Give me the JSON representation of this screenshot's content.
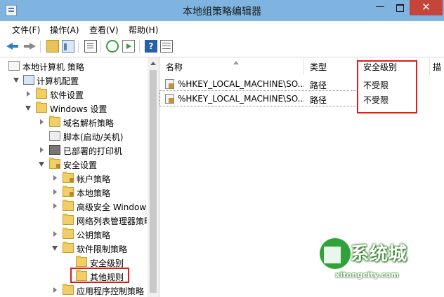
{
  "window": {
    "title": "本地组策略编辑器",
    "minimize": "—",
    "close": "✕"
  },
  "menu": [
    "文件(F)",
    "操作(A)",
    "查看(V)",
    "帮助(H)"
  ],
  "toolbar": {
    "help_glyph": "?"
  },
  "tree": [
    {
      "label": "本地计算机 策略",
      "icon": "policy-doc-icon"
    },
    {
      "label": "计算机配置",
      "icon": "computer-icon"
    },
    {
      "label": "软件设置",
      "icon": "folder-icon"
    },
    {
      "label": "Windows 设置",
      "icon": "folder-icon"
    },
    {
      "label": "域名解析策略",
      "icon": "folder-icon"
    },
    {
      "label": "脚本(启动/关机)",
      "icon": "script-icon"
    },
    {
      "label": "已部署的打印机",
      "icon": "printer-icon"
    },
    {
      "label": "安全设置",
      "icon": "secure-folder-icon"
    },
    {
      "label": "帐户策略",
      "icon": "secure-folder-icon"
    },
    {
      "label": "本地策略",
      "icon": "secure-folder-icon"
    },
    {
      "label": "高级安全 Windows",
      "icon": "folder-icon"
    },
    {
      "label": "网络列表管理器策略",
      "icon": "folder-icon"
    },
    {
      "label": "公钥策略",
      "icon": "folder-icon"
    },
    {
      "label": "软件限制策略",
      "icon": "folder-icon"
    },
    {
      "label": "安全级别",
      "icon": "folder-icon"
    },
    {
      "label": "其他规则",
      "icon": "folder-icon"
    },
    {
      "label": "应用程序控制策略",
      "icon": "folder-icon"
    }
  ],
  "columns": {
    "name": "名称",
    "type": "类型",
    "level": "安全级别",
    "extra": "描"
  },
  "rules": [
    {
      "name": "%HKEY_LOCAL_MACHINE\\SO...",
      "type": "路径",
      "level": "不受限"
    },
    {
      "name": "%HKEY_LOCAL_MACHINE\\SO...",
      "type": "路径",
      "level": "不受限"
    }
  ],
  "watermark": {
    "title": "系统城",
    "url": "xitongcity.com"
  },
  "colors": {
    "titlebar": "#7fb4e0",
    "close": "#c7443a",
    "highlight": "#e21a1a",
    "watermark": "#2fa33a"
  }
}
